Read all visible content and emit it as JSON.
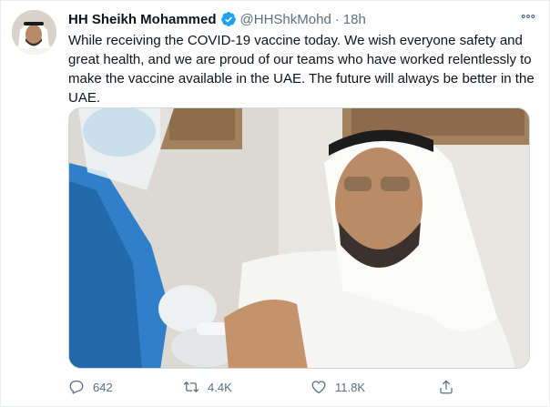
{
  "tweet": {
    "author": {
      "display_name": "HH Sheikh Mohammed",
      "handle": "@HHShkMohd",
      "verified": true,
      "avatar_icon": "profile-photo"
    },
    "separator": "·",
    "time": "18h",
    "more_icon": "more-dots-icon",
    "text": "While receiving the COVID-19 vaccine today. We wish everyone safety and great health, and we are proud of our teams who have worked relentlessly to make the vaccine available in the UAE. The future will always be better in the UAE.",
    "media": {
      "type": "photo"
    },
    "actions": {
      "reply_count": "642",
      "retweet_count": "4.4K",
      "like_count": "11.8K",
      "share_icon": "share-icon"
    }
  },
  "colors": {
    "accent": "#1da1f2",
    "secondary_text": "#5b7083",
    "primary_text": "#0f1419",
    "border": "#e6ecf0"
  }
}
